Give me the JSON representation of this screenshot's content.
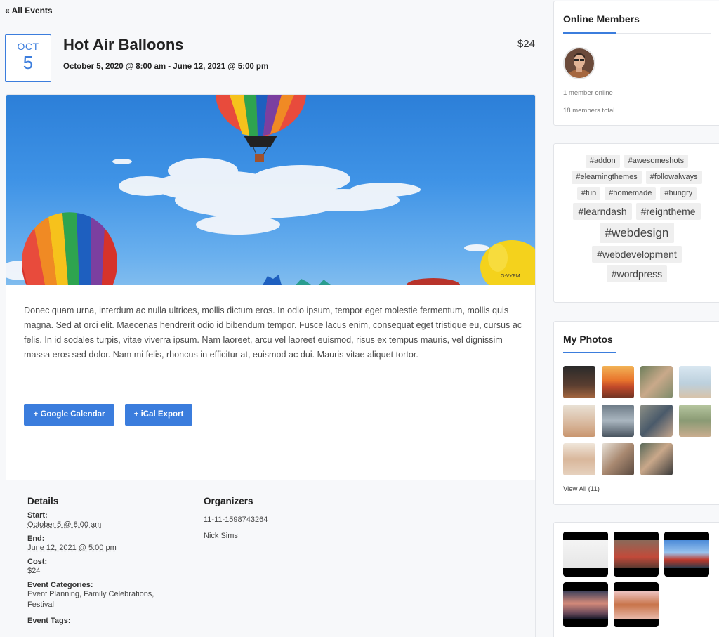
{
  "nav": {
    "back_label": "« All Events"
  },
  "event": {
    "month": "OCT",
    "day": "5",
    "title": "Hot Air Balloons",
    "dates": "October 5, 2020 @ 8:00 am - June 12, 2021 @ 5:00 pm",
    "price": "$24",
    "description": "Donec quam urna, interdum ac nulla ultrices, mollis dictum eros. In odio ipsum, tempor eget molestie fermentum, mollis quis magna. Sed at orci elit. Maecenas hendrerit odio id bibendum tempor. Fusce lacus enim, consequat eget tristique eu, cursus ac felis. In id sodales turpis, vitae viverra ipsum. Nam laoreet, arcu vel laoreet euismod, risus ex tempus mauris, vel dignissim massa eros sed dolor. Nam mi felis, rhoncus in efficitur at, euismod ac dui. Mauris vitae aliquet tortor.",
    "buttons": {
      "gcal": "+ Google Calendar",
      "ical": "+ iCal Export"
    }
  },
  "details": {
    "heading": "Details",
    "start_label": "Start:",
    "start_value": "October 5 @ 8:00 am",
    "end_label": "End:",
    "end_value": "June 12, 2021 @ 5:00 pm",
    "cost_label": "Cost:",
    "cost_value": "$24",
    "categories_label": "Event Categories:",
    "categories_value": "Event Planning, Family Celebrations, Festival",
    "tags_label": "Event Tags:"
  },
  "organizers": {
    "heading": "Organizers",
    "items": [
      "11-11-1598743264",
      "Nick Sims"
    ]
  },
  "sidebar": {
    "online": {
      "title": "Online Members",
      "online_count": "1 member online",
      "total_count": "18 members total"
    },
    "tags": [
      {
        "label": "#addon",
        "size": 11
      },
      {
        "label": "#awesomeshots",
        "size": 11
      },
      {
        "label": "#elearningthemes",
        "size": 11
      },
      {
        "label": "#followalways",
        "size": 11
      },
      {
        "label": "#fun",
        "size": 11
      },
      {
        "label": "#homemade",
        "size": 11
      },
      {
        "label": "#hungry",
        "size": 11
      },
      {
        "label": "#learndash",
        "size": 14
      },
      {
        "label": "#reigntheme",
        "size": 14
      },
      {
        "label": "#webdesign",
        "size": 17
      },
      {
        "label": "#webdevelopment",
        "size": 14
      },
      {
        "label": "#wordpress",
        "size": 14
      }
    ],
    "photos": {
      "title": "My Photos",
      "view_all": "View All (11)"
    }
  },
  "colors": {
    "accent": "#3b7ddd"
  }
}
